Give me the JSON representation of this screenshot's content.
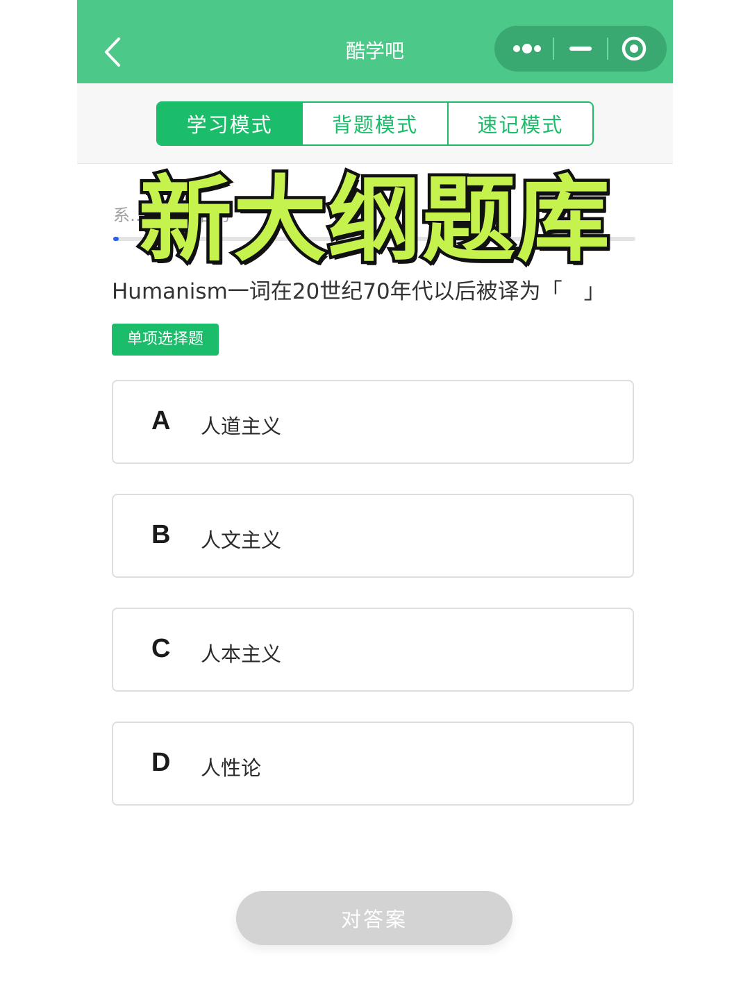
{
  "header": {
    "title": "酷学吧",
    "back_icon": "chevron-left-icon",
    "menu_icons": [
      "more-dots-icon",
      "minimize-icon",
      "record-icon"
    ]
  },
  "tabs": [
    {
      "label": "学习模式",
      "active": true
    },
    {
      "label": "背题模式",
      "active": false
    },
    {
      "label": "速记模式",
      "active": false
    }
  ],
  "subtitle": "系…诊断…后的",
  "progress": 0.01,
  "banner": "新大纲题库",
  "question": {
    "text": "Humanism一词在20世纪70年代以后被译为「　」",
    "type_label": "单项选择题"
  },
  "options": [
    {
      "letter": "A",
      "text": "人道主义"
    },
    {
      "letter": "B",
      "text": "人文主义"
    },
    {
      "letter": "C",
      "text": "人本主义"
    },
    {
      "letter": "D",
      "text": "人性论"
    }
  ],
  "submit_label": "对答案",
  "colors": {
    "header_bg": "#4cc889",
    "accent": "#1bbd6b",
    "banner_fill": "#c6f24e",
    "progress": "#2a63e8",
    "submit_disabled": "#d3d3d3"
  }
}
